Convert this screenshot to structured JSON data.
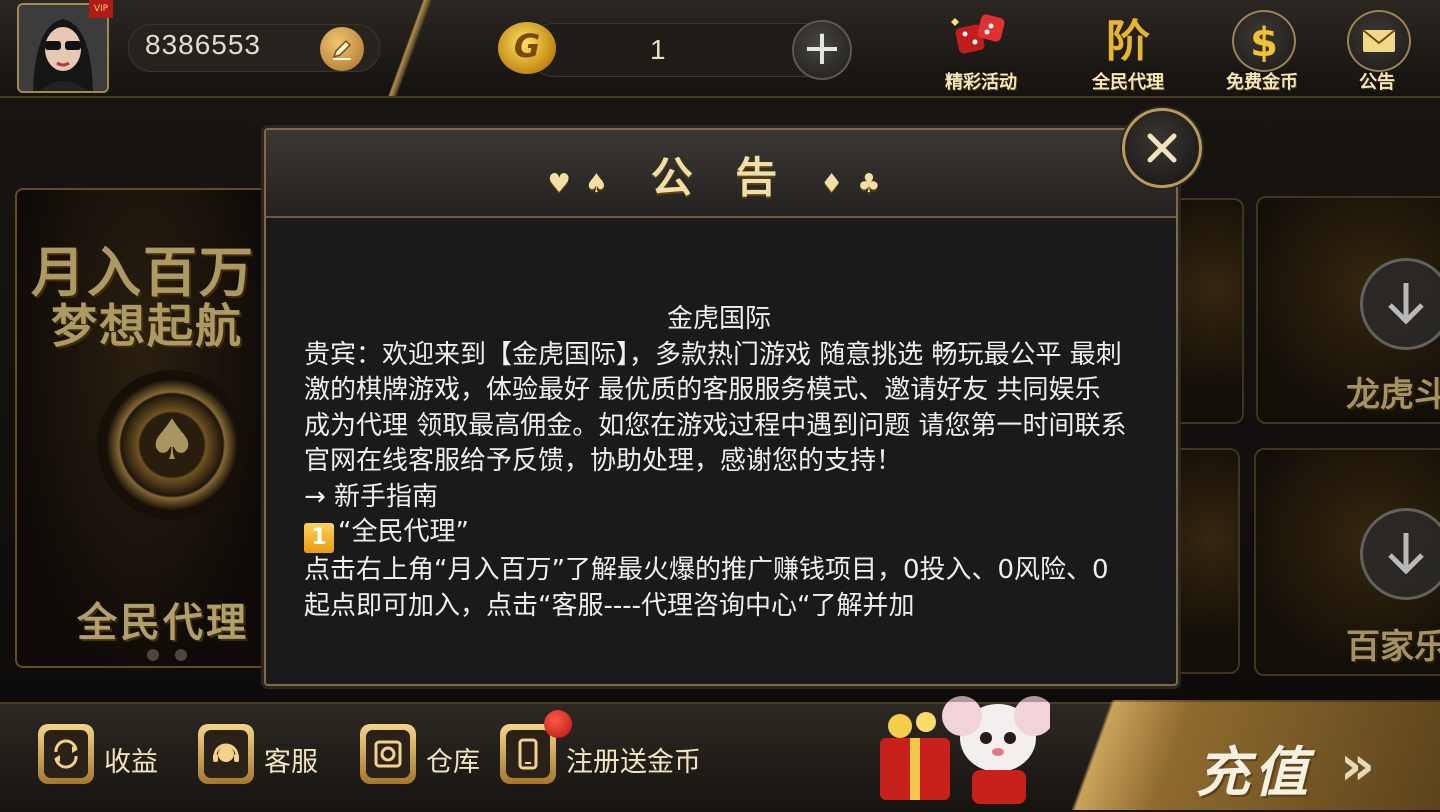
{
  "top_bar": {
    "user_id": "8386553",
    "avatar_flag": "VIP",
    "coin_symbol": "G",
    "coin_balance": "1",
    "actions": [
      {
        "label": "精彩活动",
        "icon": "dice-icon"
      },
      {
        "label": "全民代理",
        "icon": "agent-icon"
      },
      {
        "label": "免费金币",
        "icon": "free-coin-icon"
      },
      {
        "label": "公告",
        "icon": "mail-icon"
      }
    ]
  },
  "banner": {
    "line1": "月入百万",
    "line2": "梦想起航",
    "chip_glyph": "♠",
    "bottom": "全民代理"
  },
  "game_tiles": [
    {
      "label": "龙虎斗"
    },
    {
      "label": "百家乐"
    }
  ],
  "bottom_bar": {
    "items": [
      {
        "label": "收益",
        "icon": "refresh-icon"
      },
      {
        "label": "客服",
        "icon": "headset-icon"
      },
      {
        "label": "仓库",
        "icon": "safe-icon"
      },
      {
        "label": "注册送金币",
        "icon": "phone-icon"
      }
    ],
    "recharge": "充值",
    "recharge_arrows": "»"
  },
  "modal": {
    "title": "公 告",
    "suits_left": "♥♠",
    "suits_right": "♦♣",
    "close_glyph": "✕",
    "content": {
      "heading": "金虎国际",
      "paragraphs": [
        "贵宾：欢迎来到【金虎国际】，多款热门游戏 随意挑选 畅玩最公平 最刺激的棋牌游戏，体验最好  最优质的客服服务模式、邀请好友 共同娱乐  成为代理 领取最高佣金。如您在游戏过程中遇到问题  请您第一时间联系官网在线客服给予反馈，协助处理，感谢您的支持！",
        "→ 新手指南"
      ],
      "guide_number": "1",
      "guide_title": "“全民代理”",
      "guide_text": "点击右上角“月入百万”了解最火爆的推广赚钱项目，0投入、0风险、0起点即可加入，点击“客服----代理咨询中心“了解并加"
    }
  },
  "colors": {
    "gold": "#f3dfa6",
    "panel": "#1a1a1a",
    "accent_red": "#b0140c"
  }
}
